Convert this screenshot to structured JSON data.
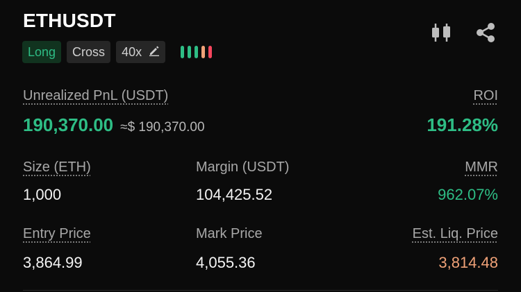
{
  "header": {
    "symbol": "ETHUSDT",
    "icons": [
      "candlestick-chart-icon",
      "share-icon"
    ]
  },
  "tags": {
    "side": "Long",
    "margin_mode": "Cross",
    "leverage": "40x"
  },
  "risk_indicator": {
    "bars": 5,
    "colors": [
      "#2ebd85",
      "#2ebd85",
      "#2ebd85",
      "#f0a278",
      "#f6465d"
    ]
  },
  "pnl": {
    "label": "Unrealized PnL (USDT)",
    "value": "190,370.00",
    "approx": "≈$ 190,370.00",
    "roi_label": "ROI",
    "roi_value": "191.28%"
  },
  "row1": {
    "size_label": "Size (ETH)",
    "size_value": "1,000",
    "margin_label": "Margin (USDT)",
    "margin_value": "104,425.52",
    "mmr_label": "MMR",
    "mmr_value": "962.07%"
  },
  "row2": {
    "entry_label": "Entry Price",
    "entry_value": "3,864.99",
    "mark_label": "Mark Price",
    "mark_value": "4,055.36",
    "liq_label": "Est. Liq. Price",
    "liq_value": "3,814.48"
  },
  "colors": {
    "positive": "#2ebd85",
    "warning": "#f0a278",
    "background": "#0b0b0b"
  }
}
